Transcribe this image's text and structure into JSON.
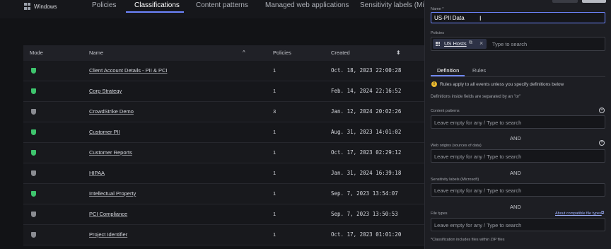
{
  "os": {
    "label": "Windows"
  },
  "tabs": [
    {
      "label": "Policies"
    },
    {
      "label": "Classifications",
      "active": true
    },
    {
      "label": "Content patterns"
    },
    {
      "label": "Managed web applications"
    },
    {
      "label": "Sensitivity labels (Micro"
    }
  ],
  "table": {
    "headers": {
      "mode": "Mode",
      "name": "Name",
      "policies": "Policies",
      "created": "Created"
    },
    "rows": [
      {
        "mode": "on",
        "name": "Client Account Details - PII & PCI",
        "policies": "1",
        "created": "Oct. 18, 2023 22:00:28"
      },
      {
        "mode": "on",
        "name": "Corp Strategy",
        "policies": "1",
        "created": "Feb. 14, 2024 22:16:52"
      },
      {
        "mode": "off",
        "name": "CrowdStrike Demo",
        "policies": "3",
        "created": "Jan. 12, 2024 20:02:26"
      },
      {
        "mode": "on",
        "name": "Customer PII",
        "policies": "1",
        "created": "Aug. 31, 2023 14:01:02"
      },
      {
        "mode": "on",
        "name": "Customer Reports",
        "policies": "1",
        "created": "Oct. 17, 2023 02:29:12"
      },
      {
        "mode": "off",
        "name": "HIPAA",
        "policies": "1",
        "created": "Jan. 31, 2024 16:39:18"
      },
      {
        "mode": "on",
        "name": "Intellectual Property",
        "policies": "1",
        "created": "Sep. 7, 2023 13:54:07"
      },
      {
        "mode": "off",
        "name": "PCI Compliance",
        "policies": "1",
        "created": "Sep. 7, 2023 13:50:53"
      },
      {
        "mode": "off",
        "name": "Project Identifier",
        "policies": "1",
        "created": "Oct. 17, 2023 01:01:20"
      }
    ]
  },
  "panel": {
    "name_label": "Name *",
    "name_value": "US-PII Data",
    "policies_label": "Policies",
    "policy_chip": "US Hosts",
    "policies_placeholder": "Type to search",
    "tab_definition": "Definition",
    "tab_rules": "Rules",
    "info": "Rules apply to all events unless you specify definitions below",
    "info2": "Definitions inside fields are separated by an \"or\"",
    "fields": [
      {
        "label": "Content patterns",
        "placeholder": "Leave empty for any / Type to search"
      },
      {
        "label": "Web origins (sources of data)",
        "placeholder": "Leave empty for any / Type to search"
      },
      {
        "label": "Sensitivity labels (Microsoft)",
        "placeholder": "Leave empty for any / Type to search"
      },
      {
        "label": "File types",
        "placeholder": "Leave empty for any / Type to search"
      }
    ],
    "and_label": "AND",
    "compat_link": "About compatible file types",
    "footnote": "*Classification includes files within ZIP files"
  }
}
